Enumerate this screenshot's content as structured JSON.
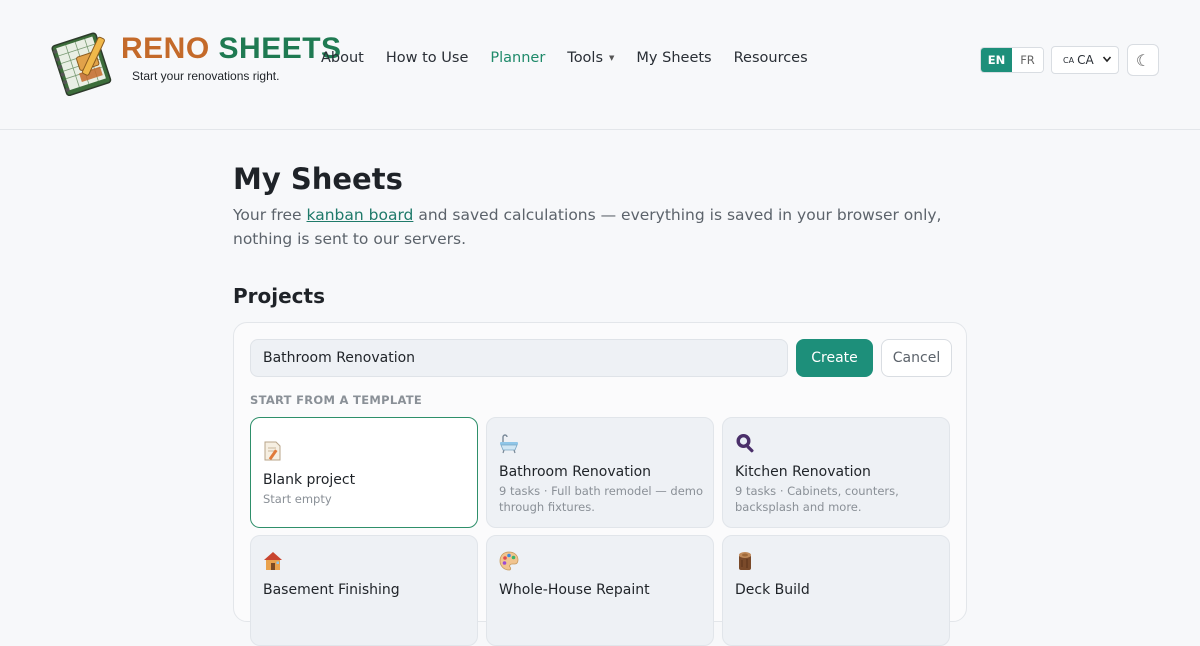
{
  "brand": {
    "reno": "RENO",
    "sheets": "SHEETS",
    "tagline": "Start your renovations right."
  },
  "nav": {
    "about": "About",
    "how_to_use": "How to Use",
    "planner": "Planner",
    "tools": "Tools",
    "my_sheets": "My Sheets",
    "resources": "Resources"
  },
  "header_controls": {
    "lang_en": "EN",
    "lang_fr": "FR",
    "region_flag": "CA",
    "region": "CA",
    "theme_icon": "☾"
  },
  "page": {
    "title": "My Sheets",
    "intro_before": "Your free ",
    "intro_link": "kanban board",
    "intro_after": " and saved calculations — everything is saved in your browser only, nothing is sent to our servers.",
    "projects_heading": "Projects"
  },
  "create_form": {
    "project_name_value": "Bathroom Renovation",
    "create_label": "Create",
    "cancel_label": "Cancel",
    "template_heading": "START FROM A TEMPLATE"
  },
  "templates": [
    {
      "title": "Blank project",
      "desc": "Start empty",
      "icon": "memo-icon",
      "selected": true
    },
    {
      "title": "Bathroom Renovation",
      "desc": "9 tasks · Full bath remodel — demo through fixtures.",
      "icon": "bathtub-icon"
    },
    {
      "title": "Kitchen Renovation",
      "desc": "9 tasks · Cabinets, counters, backsplash and more.",
      "icon": "magnifier-icon"
    },
    {
      "title": "Basement Finishing",
      "desc": "",
      "icon": "house-icon"
    },
    {
      "title": "Whole-House Repaint",
      "desc": "",
      "icon": "palette-icon"
    },
    {
      "title": "Deck Build",
      "desc": "",
      "icon": "log-icon"
    }
  ],
  "colors": {
    "accent": "#1d8f7a",
    "brand_orange": "#c46a2a",
    "brand_green": "#1f7a52",
    "link": "#1f7a6a"
  }
}
